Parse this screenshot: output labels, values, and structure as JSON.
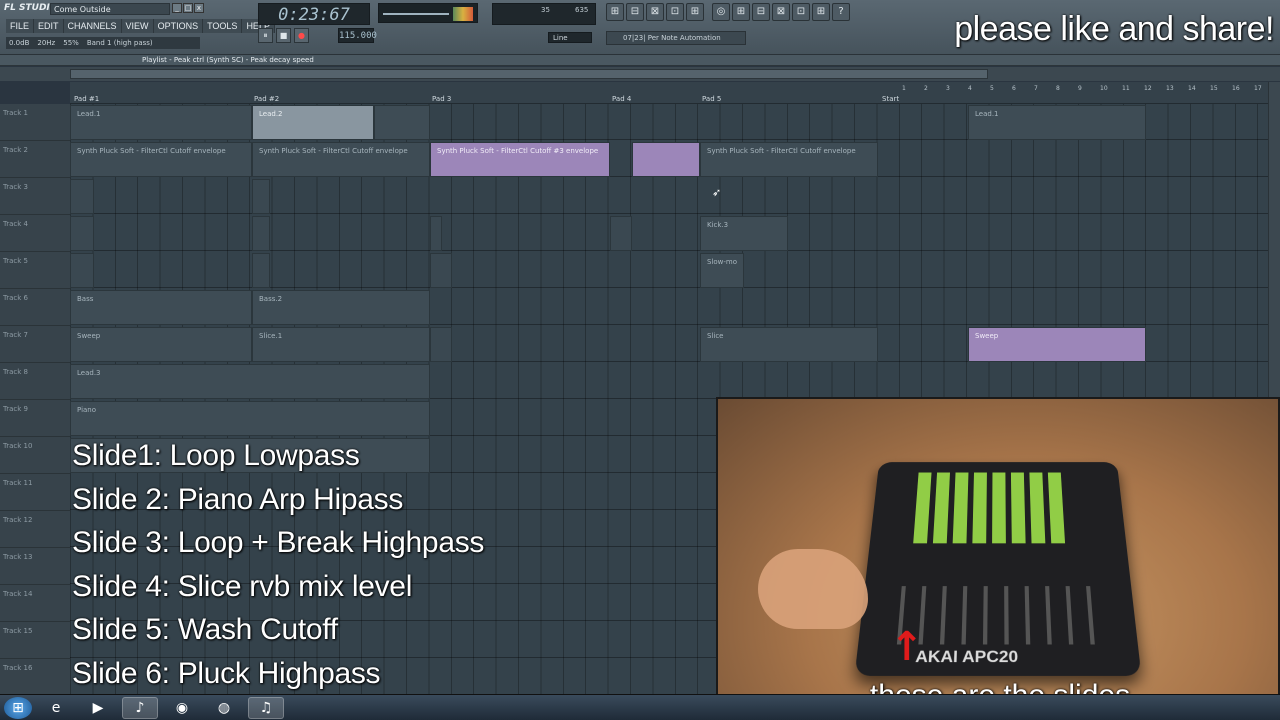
{
  "app": {
    "logo": "FL STUDIO",
    "song_name": "Come Outside",
    "window_buttons": [
      "_",
      "□",
      "x"
    ]
  },
  "menu": [
    "FILE",
    "EDIT",
    "CHANNELS",
    "VIEW",
    "OPTIONS",
    "TOOLS",
    "HELP"
  ],
  "hint_bar": [
    "0.0dB",
    "20Hz",
    "55%",
    "Band 1 (high pass)"
  ],
  "transport": {
    "time": "0:23:67",
    "tempo": "115.000",
    "buttons": [
      "⏸",
      "■",
      "●"
    ],
    "cpu": "35",
    "memory": "635",
    "snap_mode": "Line",
    "hint_panel": "07|23| Per Note Automation"
  },
  "toolbar_icons": [
    "⊞",
    "⊟",
    "⊠",
    "⊡",
    "⊞",
    "⊟",
    "◎",
    "⊞",
    "⊟",
    "⊠",
    "⊡",
    "⊞",
    "?"
  ],
  "overlay_top": "please like and share!",
  "playlist": {
    "title": "Playlist - Peak ctrl (Synth SC) - Peak decay speed",
    "patterns": [
      "Pad #1",
      "Pad #2",
      "Pad 3",
      "Pad 4",
      "Pad 5",
      "Start"
    ],
    "bar_numbers": [
      "1",
      "2",
      "3",
      "4",
      "5",
      "6",
      "7",
      "8",
      "9",
      "10",
      "11",
      "12",
      "13",
      "14",
      "15",
      "16",
      "17"
    ],
    "tracks": [
      "Track 1",
      "Track 2",
      "Track 3",
      "Track 4",
      "Track 5",
      "Track 6",
      "Track 7",
      "Track 8",
      "Track 9",
      "Track 10",
      "Track 11",
      "Track 12",
      "Track 13",
      "Track 14",
      "Track 15",
      "Track 16"
    ],
    "clips": {
      "lead1": "Lead.1",
      "lead2": "Lead.2",
      "lead1b": "Lead.1",
      "synth1": "Synth Pluck Soft - FilterCtl Cutoff envelope",
      "synth2": "Synth Pluck Soft - FilterCtl Cutoff envelope",
      "synth3": "Synth Pluck Soft - FilterCtl Cutoff #3 envelope",
      "synth4": "Synth Pluck Soft - FilterCtl Cutoff envelope",
      "kick": "Kick.3",
      "slowmo": "Slow-mo",
      "bass1": "Bass",
      "bass2": "Bass.2",
      "sweep1": "Sweep",
      "slice1": "Slice.1",
      "slice": "Slice",
      "sweep2": "Sweep",
      "lead3": "Lead.3",
      "piano": "Piano"
    }
  },
  "slides": [
    "Slide1: Loop Lowpass",
    "Slide 2: Piano Arp Hipass",
    "Slide 3: Loop + Break Highpass",
    "Slide 4: Slice rvb mix level",
    "Slide 5: Wash Cutoff",
    "Slide 6: Pluck Highpass"
  ],
  "webcam": {
    "brand": "AKAI APC20",
    "caption": "those are the slides"
  },
  "taskbar": {
    "icons": [
      "windows-start-icon",
      "internet-explorer-icon",
      "media-player-icon",
      "winamp-icon",
      "chrome-icon",
      "firefox-icon",
      "fl-studio-icon"
    ]
  }
}
